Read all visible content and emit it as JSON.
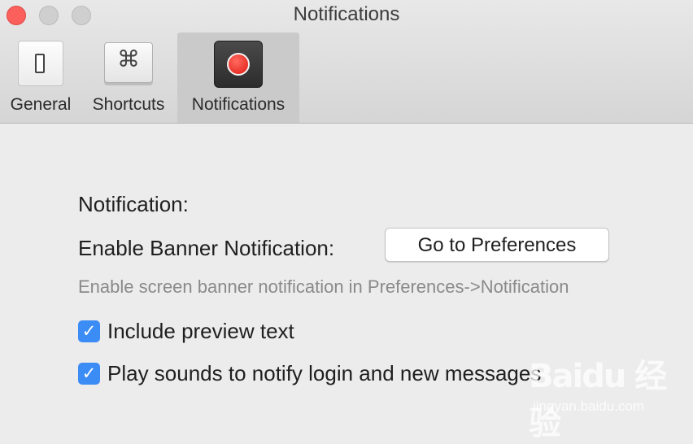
{
  "window": {
    "title": "Notifications"
  },
  "toolbar": {
    "tabs": [
      {
        "label": "General",
        "icon": "toggle-switch-icon",
        "selected": false
      },
      {
        "label": "Shortcuts",
        "icon": "command-key-icon",
        "glyph": "⌘",
        "selected": false
      },
      {
        "label": "Notifications",
        "icon": "record-icon",
        "selected": true
      }
    ]
  },
  "content": {
    "heading": "Notification:",
    "banner_label": "Enable Banner Notification:",
    "preferences_button": "Go to Preferences",
    "hint": "Enable screen banner notification in Preferences->Notification",
    "checkboxes": [
      {
        "label": "Include preview text",
        "checked": true
      },
      {
        "label": "Play sounds to notify login and new messages",
        "checked": true
      }
    ],
    "check_glyph": "✓"
  },
  "watermark": {
    "logo": "Baidu 经验",
    "url": "jingyan.baidu.com"
  },
  "colors": {
    "close": "#fc605c",
    "checkbox": "#3b8cf5",
    "record": "#e01a12"
  }
}
